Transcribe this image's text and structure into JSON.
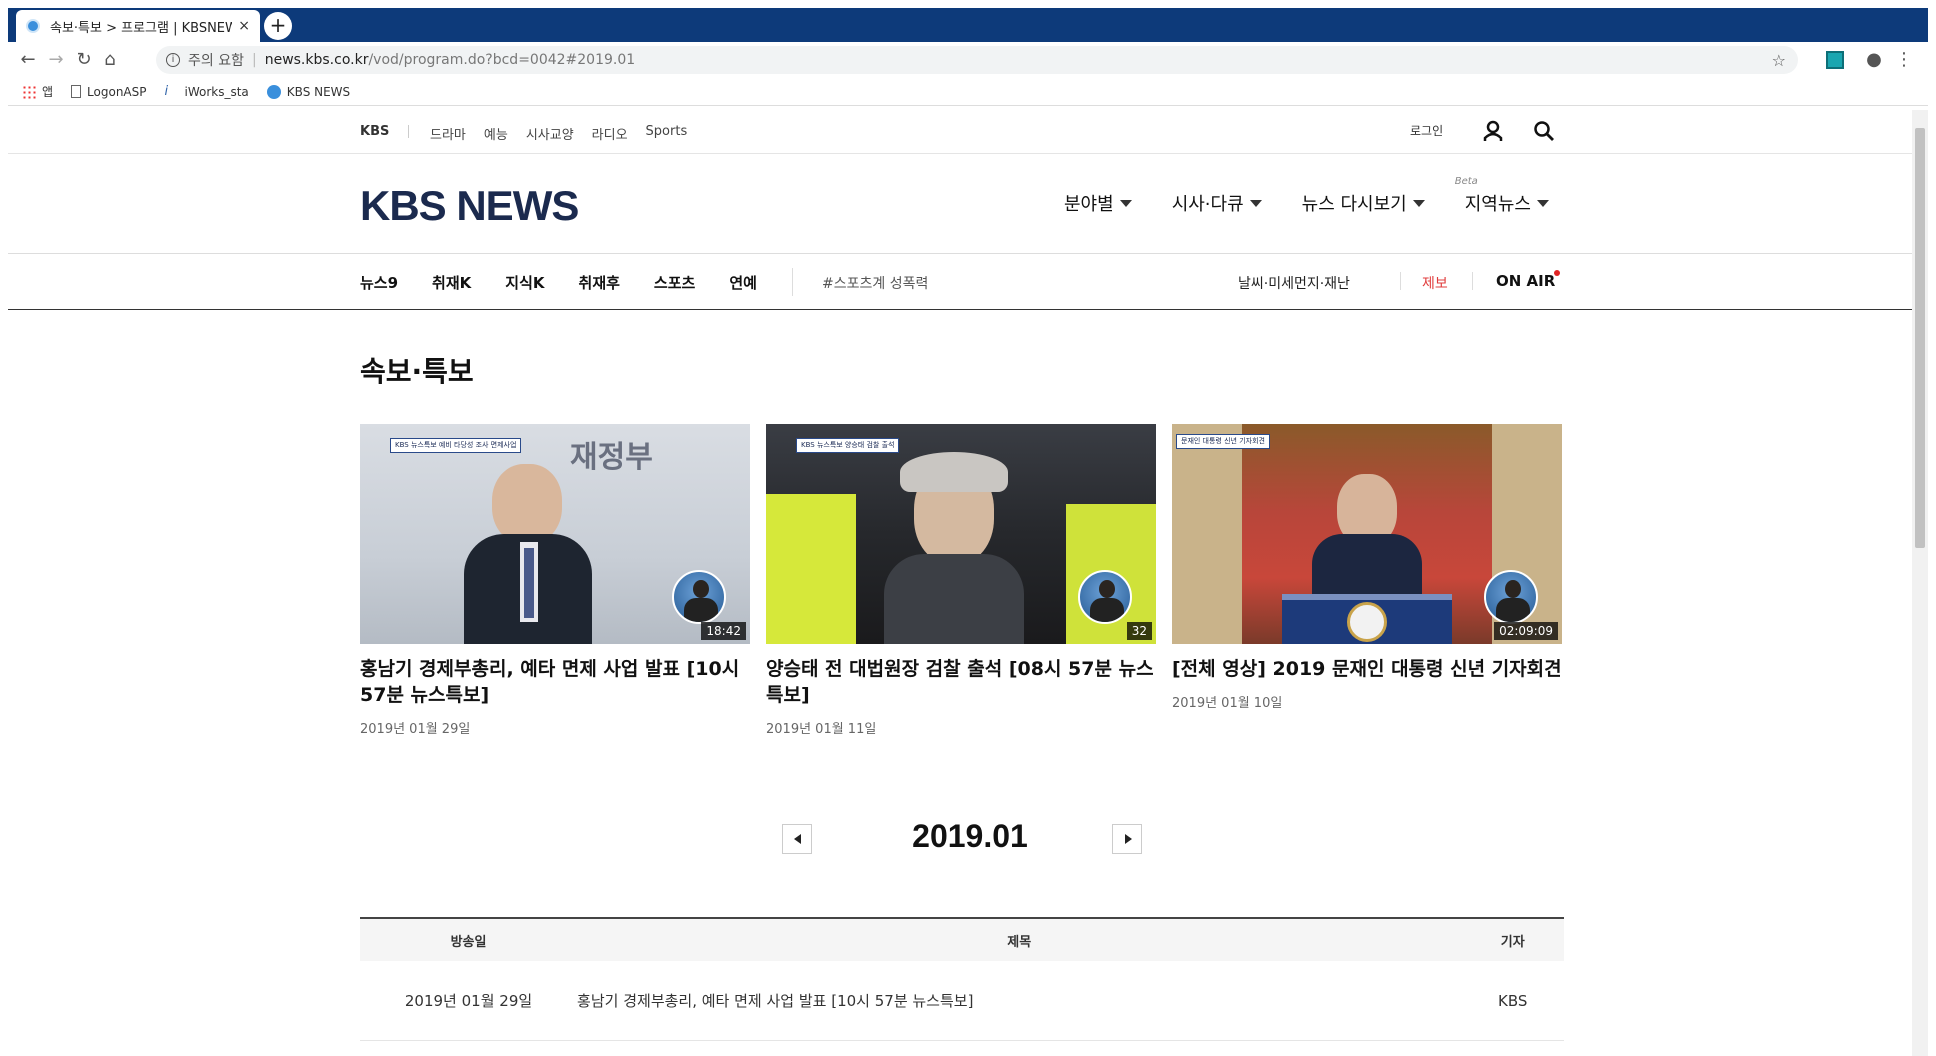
{
  "browser": {
    "tab_title": "속보·특보 > 프로그램 | KBSNEWS",
    "tab_close": "×",
    "new_tab": "+",
    "security_label": "주의 요함",
    "url_host": "news.kbs.co.kr",
    "url_path": "/vod/program.do?bcd=0042#2019.01",
    "bookmarks": [
      {
        "label": "앱",
        "icon": "apps-icon"
      },
      {
        "label": "LogonASP",
        "icon": "page-icon"
      },
      {
        "label": "iWorks_sta",
        "icon": "iworks-icon"
      },
      {
        "label": "KBS NEWS",
        "icon": "kbs-icon"
      }
    ]
  },
  "topnav": {
    "brand": "KBS",
    "links": [
      "드라마",
      "예능",
      "시사교양",
      "라디오",
      "Sports"
    ],
    "login": "로그인"
  },
  "header": {
    "logo": "KBS NEWS",
    "menu": [
      {
        "label": "분야별"
      },
      {
        "label": "시사·다큐"
      },
      {
        "label": "뉴스 다시보기"
      },
      {
        "label": "지역뉴스",
        "badge": "Beta"
      }
    ]
  },
  "subnav": {
    "items": [
      "뉴스9",
      "취재K",
      "지식K",
      "취재후",
      "스포츠",
      "연예"
    ],
    "tag": "#스포츠계 성폭력",
    "weather": "날씨·미세먼지·재난",
    "report": "제보",
    "onair": "ON AIR"
  },
  "section": {
    "title": "속보·특보"
  },
  "cards": [
    {
      "title": "홍남기 경제부총리, 예타 면제 사업 발표 [10시 57분 뉴스특보]",
      "date": "2019년 01월 29일",
      "duration": "18:42",
      "caption": "KBS 뉴스특보 예비 타당성 조사 면제사업"
    },
    {
      "title": "양승태 전 대법원장 검찰 출석 [08시 57분 뉴스특보]",
      "date": "2019년 01월 11일",
      "duration": "32",
      "caption": "KBS 뉴스특보 양승태 검찰 출석"
    },
    {
      "title": "[전체 영상] 2019 문재인 대통령 신년 기자회견",
      "date": "2019년 01월 10일",
      "duration": "02:09:09",
      "caption": "문재인 대통령 신년 기자회견"
    }
  ],
  "thumb_text": {
    "card0_sign": "재정부"
  },
  "pager": {
    "current": "2019.01"
  },
  "table": {
    "headers": [
      "방송일",
      "제목",
      "기자"
    ],
    "rows": [
      {
        "date": "2019년 01월 29일",
        "title": "홍남기 경제부총리, 예타 면제 사업 발표 [10시 57분 뉴스특보]",
        "reporter": "KBS"
      }
    ]
  }
}
